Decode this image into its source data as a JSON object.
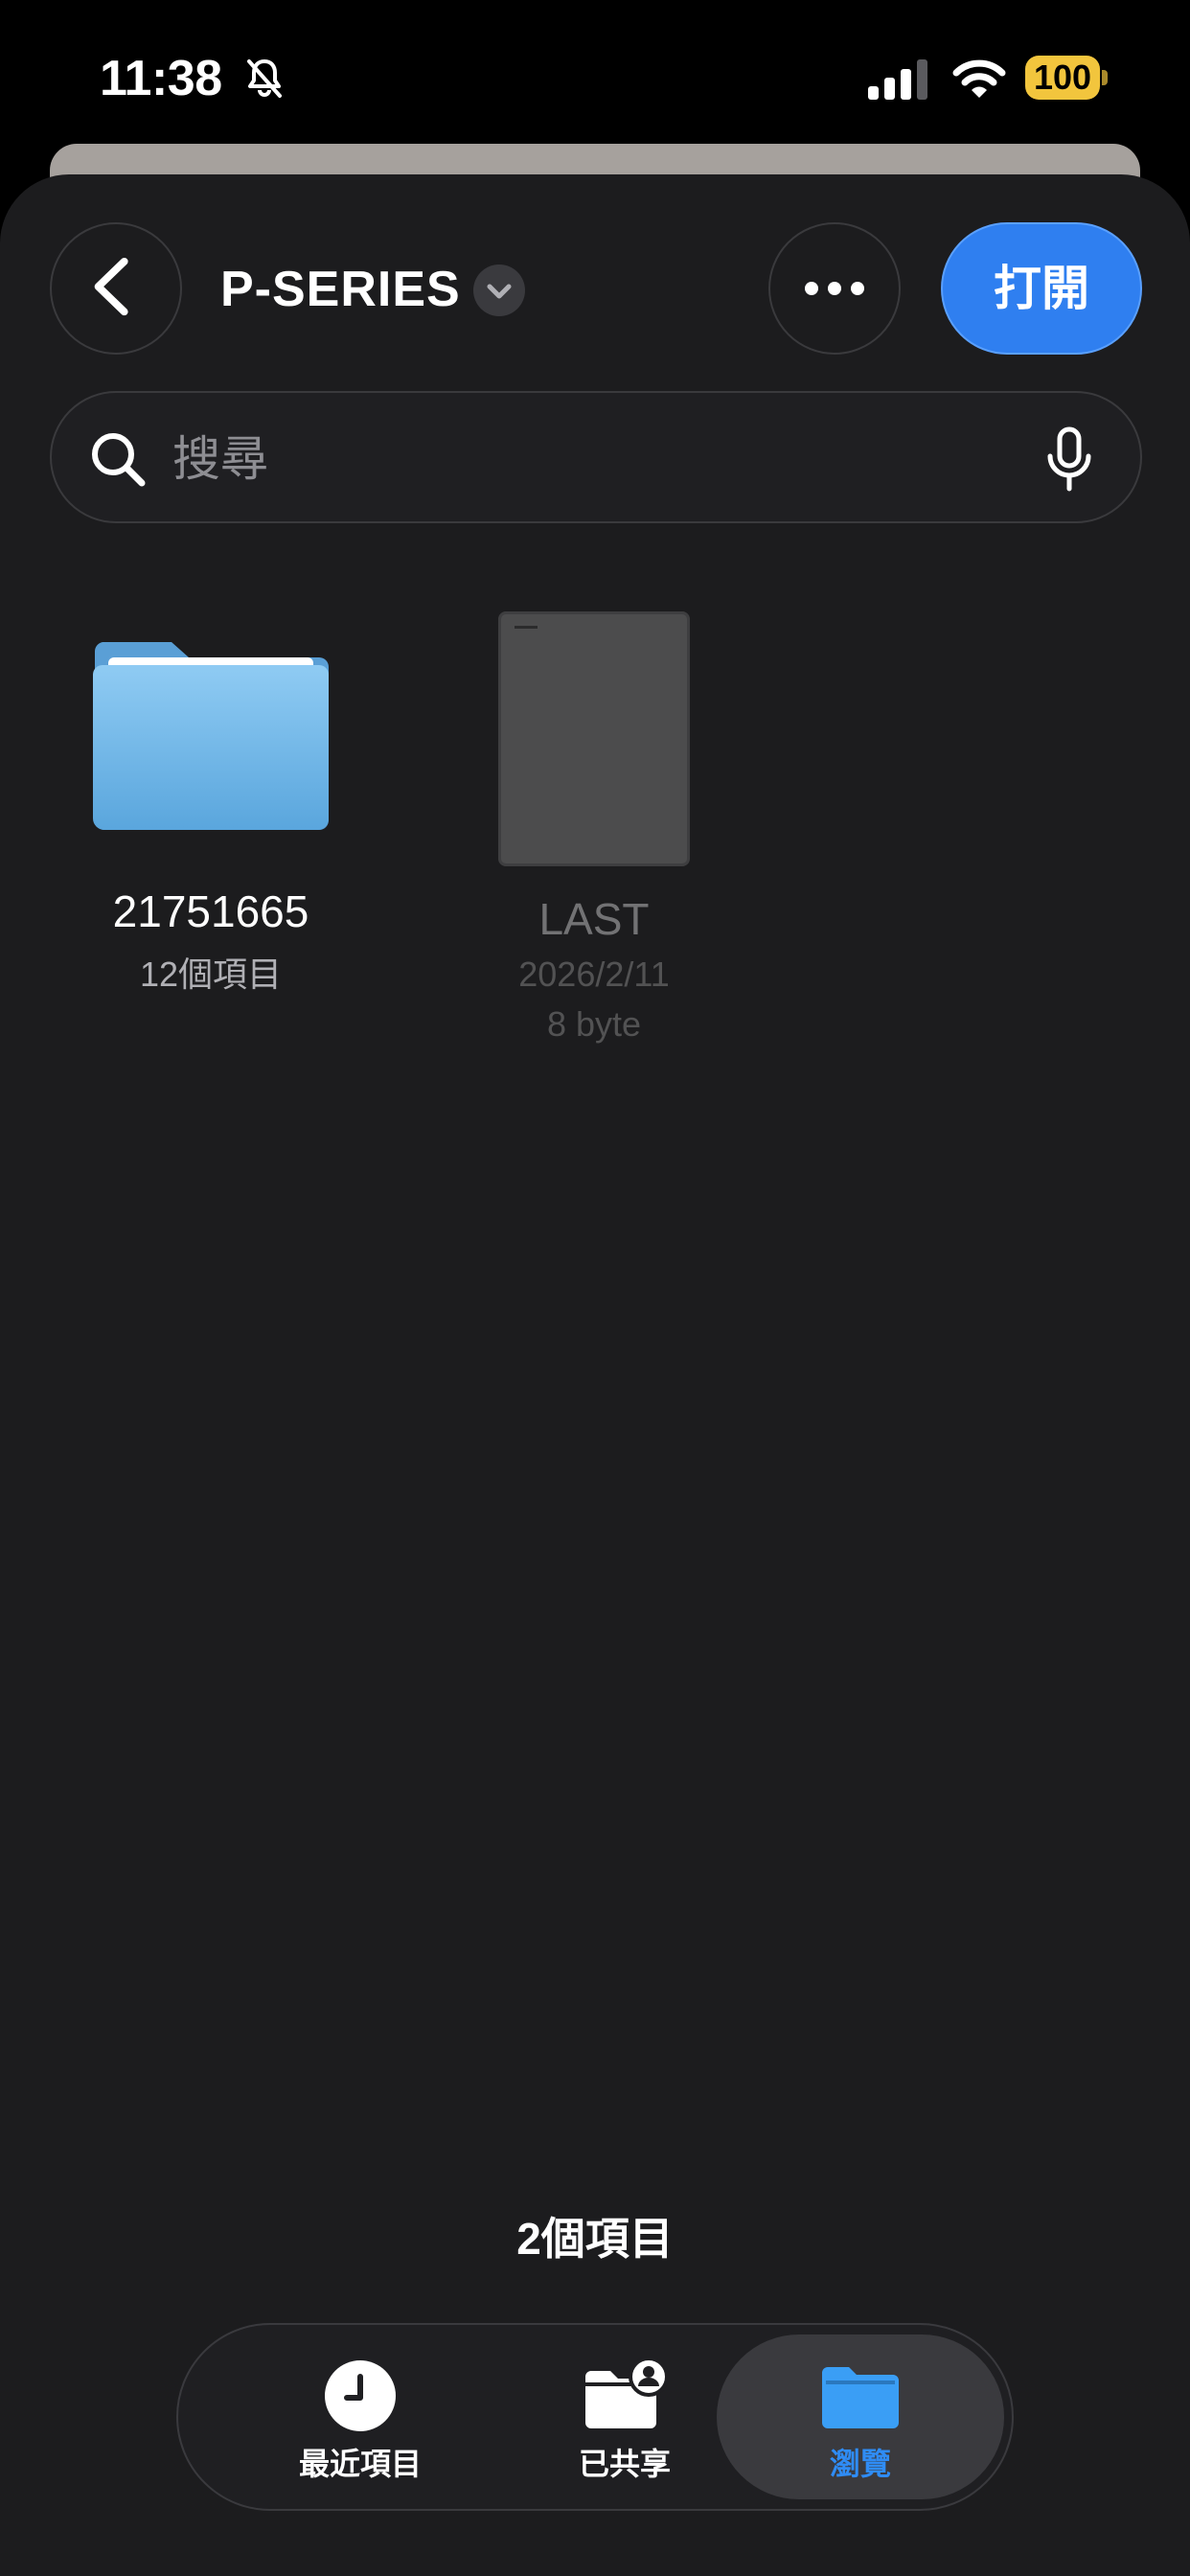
{
  "status_bar": {
    "time": "11:38",
    "battery": "100"
  },
  "header": {
    "title": "P-SERIES",
    "open_label": "打開"
  },
  "search": {
    "placeholder": "搜尋"
  },
  "items": [
    {
      "name": "21751665",
      "meta1": "12個項目",
      "type": "folder"
    },
    {
      "name": "LAST",
      "meta1": "2026/2/11",
      "meta2": "8 byte",
      "type": "file"
    }
  ],
  "summary": {
    "count": "2個項目"
  },
  "tabs": [
    {
      "label": "最近項目",
      "icon": "clock-icon"
    },
    {
      "label": "已共享",
      "icon": "shared-folder-icon"
    },
    {
      "label": "瀏覽",
      "icon": "folder-icon",
      "selected": true
    }
  ],
  "colors": {
    "accent": "#2f7ff0",
    "background": "#1c1c1e",
    "battery": "#f2c53d"
  }
}
